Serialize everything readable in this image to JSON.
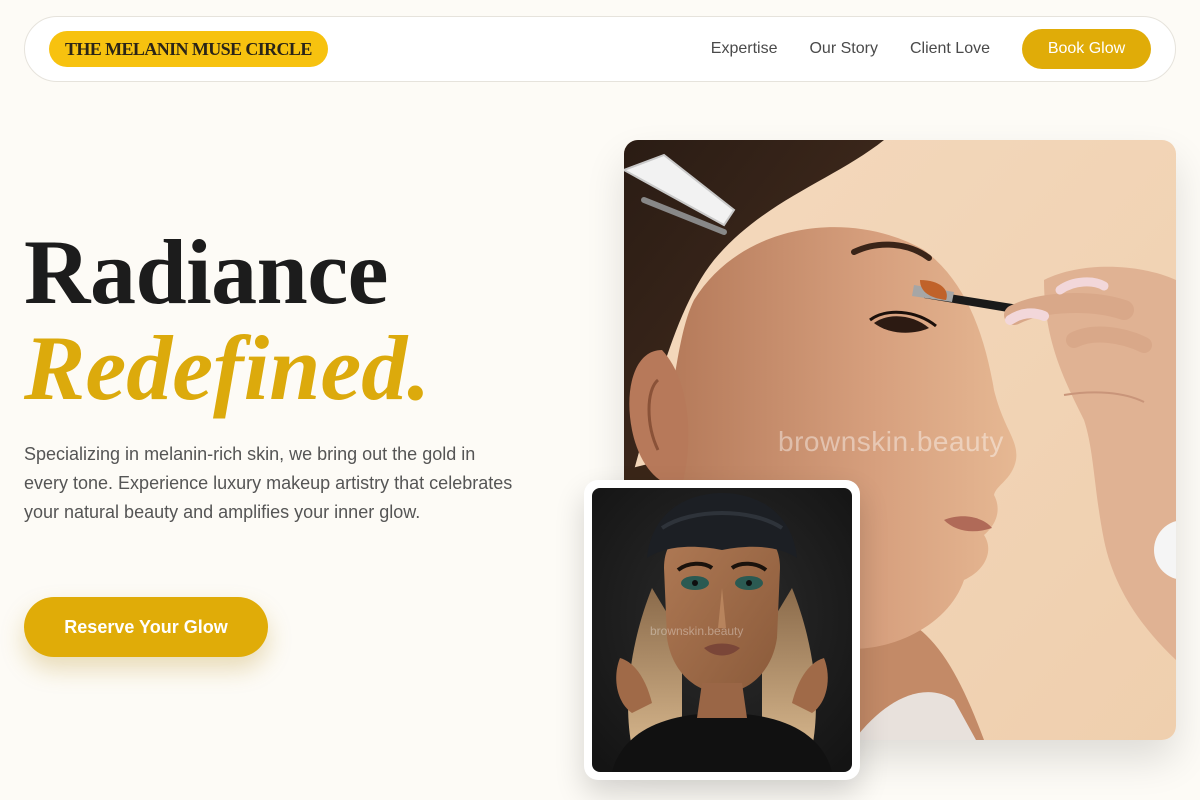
{
  "nav": {
    "brand": "THE MELANIN MUSE CIRCLE",
    "links": [
      "Expertise",
      "Our Story",
      "Client Love"
    ],
    "cta_label": "Book Glow"
  },
  "hero": {
    "title_line1": "Radiance",
    "title_line2": "Redefined.",
    "description": "Specializing in melanin-rich skin, we bring out the gold in every tone. Experience luxury makeup artistry that celebrates your natural beauty and amplifies your inner glow.",
    "cta_label": "Reserve Your Glow"
  },
  "images": {
    "main_photo": {
      "subject": "makeup-artist-applying-brush-to-eyelid",
      "watermark": "brownskin.beauty"
    },
    "inset_photo": {
      "subject": "portrait-woman-black-turban-glam-makeup",
      "watermark": "brownskin.beauty"
    }
  },
  "colors": {
    "page_bg": "#fdfbf6",
    "brand_yellow": "#f7c20f",
    "gold": "#e0ac08",
    "accent_text": "#dcaa0c",
    "dark_text": "#1c1c1c",
    "body_text": "#555555"
  }
}
